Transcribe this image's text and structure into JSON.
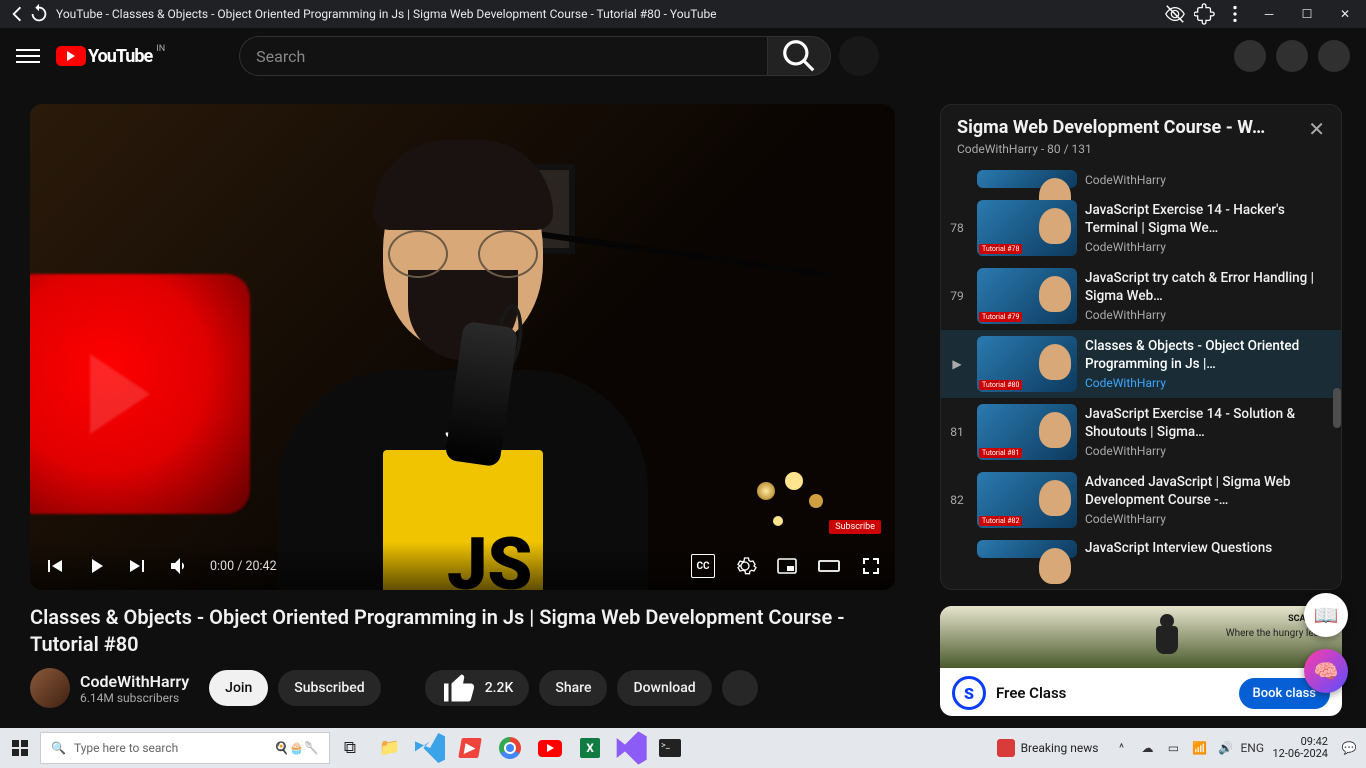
{
  "browser": {
    "page_title": "YouTube - Classes & Objects - Object Oriented Programming in Js | Sigma Web Development Course - Tutorial #80 - YouTube"
  },
  "header": {
    "logo_text": "YouTube",
    "country_code": "IN",
    "search_placeholder": "Search"
  },
  "video": {
    "title": "Classes & Objects - Object Oriented Programming in Js | Sigma Web Development Course - Tutorial #80",
    "subscribe_badge": "Subscribe",
    "shirt_text_small": "JS",
    "shirt_text_big": "JS",
    "time_current": "0:00",
    "time_total": "20:42",
    "cc_label": "CC"
  },
  "channel": {
    "name": "CodeWithHarry",
    "subscribers": "6.14M subscribers"
  },
  "actions": {
    "join": "Join",
    "subscribed": "Subscribed",
    "likes": "2.2K",
    "share": "Share",
    "download": "Download"
  },
  "playlist": {
    "title": "Sigma Web Development Course - W…",
    "subtitle": "CodeWithHarry - 80 / 131",
    "items": [
      {
        "index": "",
        "tag": "",
        "title": "",
        "channel": "CodeWithHarry",
        "active": false,
        "trailing": true
      },
      {
        "index": "78",
        "tag": "Tutorial #78",
        "title": "JavaScript Exercise 14 - Hacker's Terminal | Sigma We…",
        "channel": "CodeWithHarry",
        "active": false
      },
      {
        "index": "79",
        "tag": "Tutorial #79",
        "title": "JavaScript try catch & Error Handling | Sigma Web…",
        "channel": "CodeWithHarry",
        "active": false
      },
      {
        "index": "▶",
        "tag": "Tutorial #80",
        "title": "Classes & Objects - Object Oriented Programming in Js |…",
        "channel": "CodeWithHarry",
        "active": true
      },
      {
        "index": "81",
        "tag": "Tutorial #81",
        "title": "JavaScript Exercise 14 - Solution & Shoutouts | Sigma…",
        "channel": "CodeWithHarry",
        "active": false
      },
      {
        "index": "82",
        "tag": "Tutorial #82",
        "title": "Advanced JavaScript | Sigma Web Development Course -…",
        "channel": "CodeWithHarry",
        "active": false
      },
      {
        "index": "",
        "tag": "",
        "title": "JavaScript Interview Questions",
        "channel": "",
        "active": false,
        "cut": true
      }
    ]
  },
  "ad": {
    "brand": "SCALER ▸",
    "tagline": "Where the hungry learn",
    "title": "Free Class",
    "button": "Book class"
  },
  "taskbar": {
    "search_placeholder": "Type here to search",
    "news": "Breaking news",
    "lang": "ENG",
    "time": "09:42",
    "date": "12-06-2024"
  }
}
